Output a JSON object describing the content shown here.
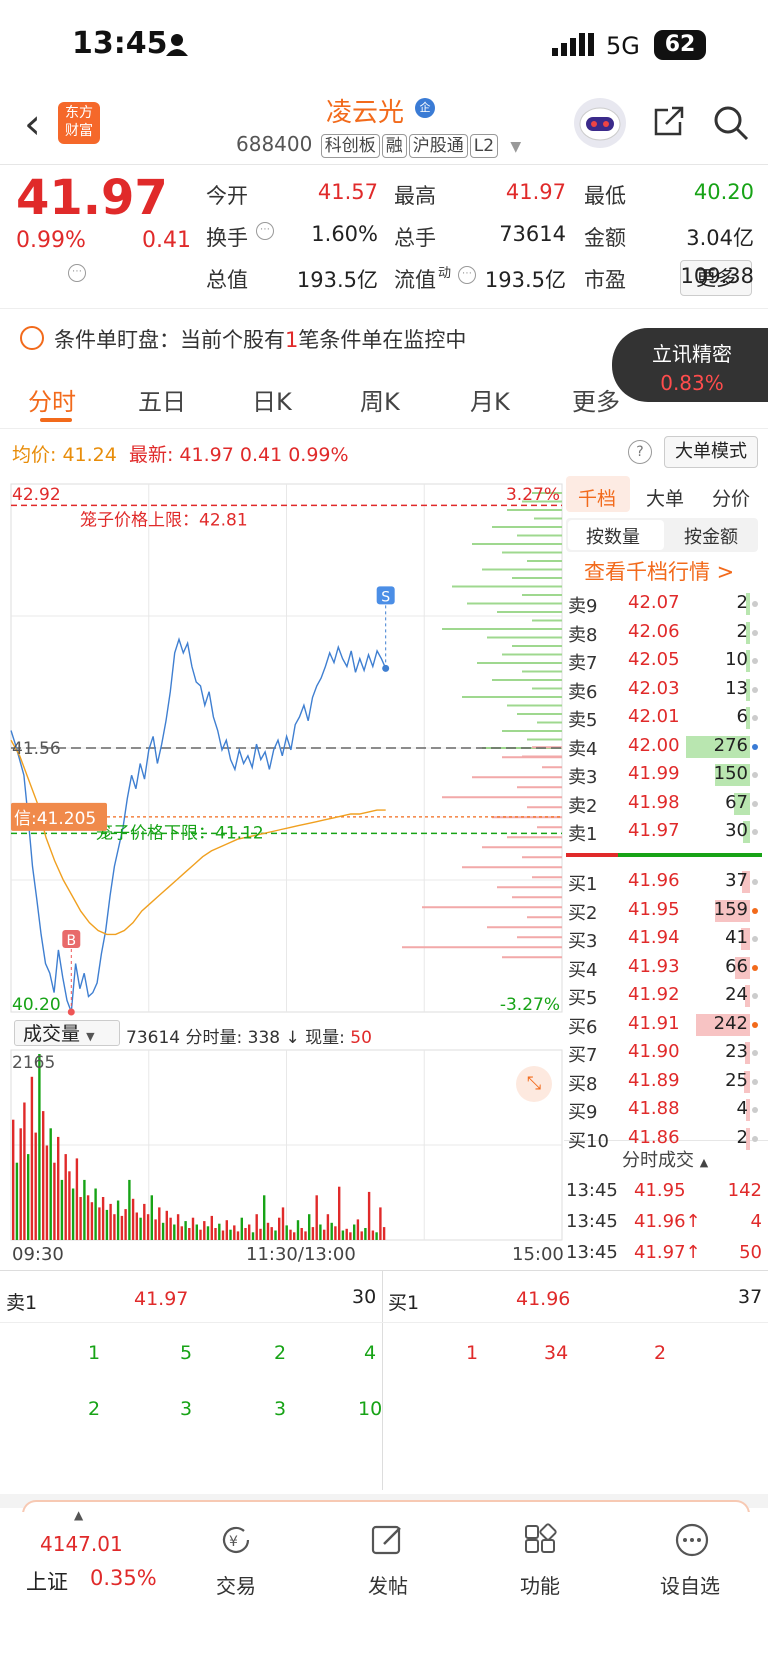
{
  "status": {
    "time": "13:45",
    "network": "5G",
    "battery": "62"
  },
  "header": {
    "stock_name": "凌云光",
    "badge": "企",
    "code": "688400",
    "tags": [
      "科创板",
      "融",
      "沪股通",
      "L2"
    ],
    "icons": [
      "back-icon",
      "share-icon",
      "search-icon"
    ],
    "app_logo_line1": "东方",
    "app_logo_line2": "财富"
  },
  "quote": {
    "price": "41.97",
    "pct": "0.99%",
    "change": "0.41",
    "fields": [
      {
        "label": "今开",
        "value": "41.57",
        "color": "red"
      },
      {
        "label": "最高",
        "value": "41.97",
        "color": "red"
      },
      {
        "label": "最低",
        "value": "40.20",
        "color": "green"
      },
      {
        "label": "换手",
        "value": "1.60%",
        "color": "dark"
      },
      {
        "label": "总手",
        "value": "73614",
        "color": "dark"
      },
      {
        "label": "金额",
        "value": "3.04亿",
        "color": "dark"
      },
      {
        "label": "总值",
        "value": "193.5亿",
        "color": "dark"
      },
      {
        "label": "流值",
        "value": "193.5亿",
        "color": "dark"
      },
      {
        "label": "市盈",
        "value": "109.38",
        "color": "dark"
      }
    ],
    "pe_superscript": "动",
    "more_button": "更多"
  },
  "condition": {
    "label": "条件单盯盘：",
    "text_pre": "当前个股有",
    "count": "1",
    "text_post": "笔条件单在监控中"
  },
  "lixun": {
    "title": "立讯精密",
    "pct": "0.83%"
  },
  "tabs": [
    "分时",
    "五日",
    "日K",
    "周K",
    "月K",
    "更多"
  ],
  "active_tab": "分时",
  "infobar": {
    "avg_label": "均价:",
    "avg": "41.24",
    "latest_label": "最新:",
    "latest": "41.97",
    "change": "0.41",
    "pct": "0.99%",
    "help": "?",
    "big_order_mode": "大单模式"
  },
  "chart_data": {
    "type": "line",
    "title": "",
    "y_max_label": "42.92",
    "y_min_label": "40.20",
    "pct_max_label": "3.27%",
    "pct_min_label": "-3.27%",
    "prev_close_label": "41.56",
    "upper_limit_text": "笼子价格上限：42.81",
    "lower_limit_text": "笼子价格下限：41.12",
    "cost_tag": "信:41.205",
    "markers": [
      "B",
      "S"
    ],
    "ylim": [
      40.2,
      42.92
    ],
    "price": [
      41.65,
      41.58,
      41.5,
      41.42,
      41.2,
      40.95,
      40.78,
      40.6,
      40.45,
      40.4,
      40.3,
      40.52,
      40.38,
      40.26,
      40.2,
      40.45,
      40.32,
      40.4,
      40.28,
      40.3,
      40.35,
      40.5,
      40.62,
      40.8,
      40.95,
      41.05,
      41.15,
      41.3,
      41.42,
      41.35,
      41.48,
      41.4,
      41.55,
      41.62,
      41.48,
      41.58,
      41.7,
      41.85,
      42.05,
      42.12,
      42.05,
      42.1,
      41.98,
      41.9,
      41.88,
      41.78,
      41.85,
      41.72,
      41.65,
      41.55,
      41.6,
      41.5,
      41.45,
      41.55,
      41.48,
      41.52,
      41.46,
      41.58,
      41.5,
      41.54,
      41.45,
      41.55,
      41.6,
      41.52,
      41.62,
      41.55,
      41.68,
      41.72,
      41.78,
      41.7,
      41.82,
      41.88,
      41.92,
      41.98,
      42.05,
      42.0,
      42.08,
      42.02,
      41.98,
      42.06,
      41.95,
      42.02,
      41.96,
      42.04,
      41.98,
      42.06,
      42.02,
      41.97
    ],
    "avg": [
      41.6,
      41.52,
      41.4,
      41.28,
      41.1,
      40.98,
      40.88,
      40.8,
      40.72,
      40.66,
      40.62,
      40.6,
      40.6,
      40.62,
      40.66,
      40.72,
      40.76,
      40.8,
      40.84,
      40.88,
      40.92,
      40.96,
      41.0,
      41.03,
      41.05,
      41.07,
      41.09,
      41.1,
      41.11,
      41.12,
      41.13,
      41.14,
      41.15,
      41.16,
      41.17,
      41.18,
      41.19,
      41.2,
      41.21,
      41.22,
      41.22,
      41.23,
      41.24,
      41.24
    ],
    "volume_header": {
      "selector": "成交量",
      "total": "73614",
      "tick_label": "分时量:",
      "tick_value": "338",
      "arrow": "↓",
      "now_label": "现量:",
      "now_value": "50"
    },
    "volume_max_label": "2165",
    "volumes": [
      1400,
      900,
      1300,
      1600,
      1000,
      1900,
      1250,
      2165,
      1500,
      1100,
      1300,
      900,
      1200,
      700,
      1000,
      800,
      600,
      950,
      500,
      700,
      520,
      440,
      600,
      380,
      500,
      350,
      420,
      300,
      460,
      280,
      360,
      700,
      480,
      320,
      260,
      420,
      300,
      520,
      240,
      380,
      200,
      340,
      260,
      180,
      300,
      160,
      220,
      140,
      260,
      180,
      120,
      220,
      160,
      280,
      140,
      190,
      110,
      230,
      120,
      170,
      100,
      260,
      140,
      180,
      90,
      300,
      130,
      520,
      200,
      150,
      110,
      260,
      380,
      170,
      120,
      90,
      230,
      140,
      100,
      300,
      150,
      520,
      180,
      120,
      300,
      200,
      160,
      620,
      110,
      130,
      90,
      180,
      240,
      100,
      140,
      560,
      110,
      90,
      380,
      150
    ],
    "time_labels": [
      "09:30",
      "11:30/13:00",
      "15:00"
    ]
  },
  "right_panel": {
    "tabs": [
      "千档",
      "大单",
      "分价"
    ],
    "seg": [
      "按数量",
      "按金额"
    ],
    "link": "查看千档行情 >",
    "asks": [
      {
        "label": "卖9",
        "price": "42.07",
        "qty": "2"
      },
      {
        "label": "卖8",
        "price": "42.06",
        "qty": "2"
      },
      {
        "label": "卖7",
        "price": "42.05",
        "qty": "10"
      },
      {
        "label": "卖6",
        "price": "42.03",
        "qty": "13"
      },
      {
        "label": "卖5",
        "price": "42.01",
        "qty": "6"
      },
      {
        "label": "卖4",
        "price": "42.00",
        "qty": "276"
      },
      {
        "label": "卖3",
        "price": "41.99",
        "qty": "150"
      },
      {
        "label": "卖2",
        "price": "41.98",
        "qty": "67"
      },
      {
        "label": "卖1",
        "price": "41.97",
        "qty": "30"
      }
    ],
    "bids": [
      {
        "label": "买1",
        "price": "41.96",
        "qty": "37"
      },
      {
        "label": "买2",
        "price": "41.95",
        "qty": "159"
      },
      {
        "label": "买3",
        "price": "41.94",
        "qty": "41"
      },
      {
        "label": "买4",
        "price": "41.93",
        "qty": "66"
      },
      {
        "label": "买5",
        "price": "41.92",
        "qty": "24"
      },
      {
        "label": "买6",
        "price": "41.91",
        "qty": "242"
      },
      {
        "label": "买7",
        "price": "41.90",
        "qty": "23"
      },
      {
        "label": "买8",
        "price": "41.89",
        "qty": "25"
      },
      {
        "label": "买9",
        "price": "41.88",
        "qty": "4"
      },
      {
        "label": "买10",
        "price": "41.86",
        "qty": "2"
      }
    ],
    "trades_title": "分时成交",
    "trades": [
      {
        "time": "13:45",
        "price": "41.95",
        "qty": "142",
        "arrow": ""
      },
      {
        "time": "13:45",
        "price": "41.96↑",
        "qty": "4",
        "arrow": ""
      },
      {
        "time": "13:45",
        "price": "41.97↑",
        "qty": "50",
        "arrow": ""
      }
    ]
  },
  "book": {
    "sell_label": "卖1",
    "sell_price": "41.97",
    "sell_qty": "30",
    "buy_label": "买1",
    "buy_price": "41.96",
    "buy_qty": "37",
    "sell_queue_row1": [
      "1",
      "5",
      "2",
      "4"
    ],
    "sell_queue_row2": [
      "2",
      "3",
      "3",
      "10"
    ],
    "buy_queue_row1": [
      "1",
      "34",
      "2"
    ]
  },
  "bottom_nav": {
    "index_value": "4147.01",
    "index_name": "上证",
    "index_pct": "0.35%",
    "items": [
      "交易",
      "发帖",
      "功能",
      "设自选"
    ]
  }
}
